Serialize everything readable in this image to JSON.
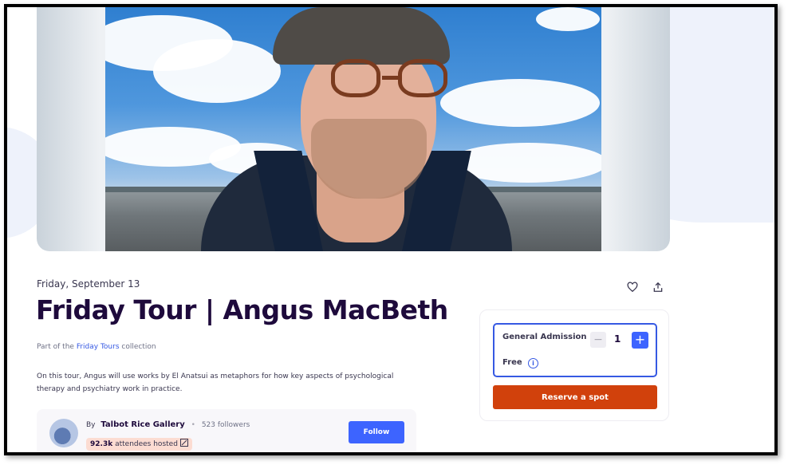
{
  "event": {
    "date": "Friday, September 13",
    "title": "Friday Tour | Angus MacBeth",
    "collection_prefix": "Part of the",
    "collection_name": "Friday Tours",
    "collection_suffix": "collection",
    "description": "On this tour, Angus will use works by El Anatsui as metaphors for how key aspects of psychological therapy and psychiatry work in practice."
  },
  "actions": {
    "like_icon": "heart-icon",
    "share_icon": "share-icon"
  },
  "organizer": {
    "by_label": "By",
    "name": "Talbot Rice Gallery",
    "followers": "523 followers",
    "attendees_count": "92.3k",
    "attendees_label": "attendees hosted",
    "follow_label": "Follow"
  },
  "ticket": {
    "type": "General Admission",
    "quantity": "1",
    "price": "Free",
    "minus_label": "−",
    "plus_label": "+",
    "reserve_label": "Reserve a spot"
  },
  "colors": {
    "title": "#1e0a3c",
    "accent": "#3d64ff",
    "reserve": "#d1410c",
    "badge": "#fcdcd2"
  }
}
